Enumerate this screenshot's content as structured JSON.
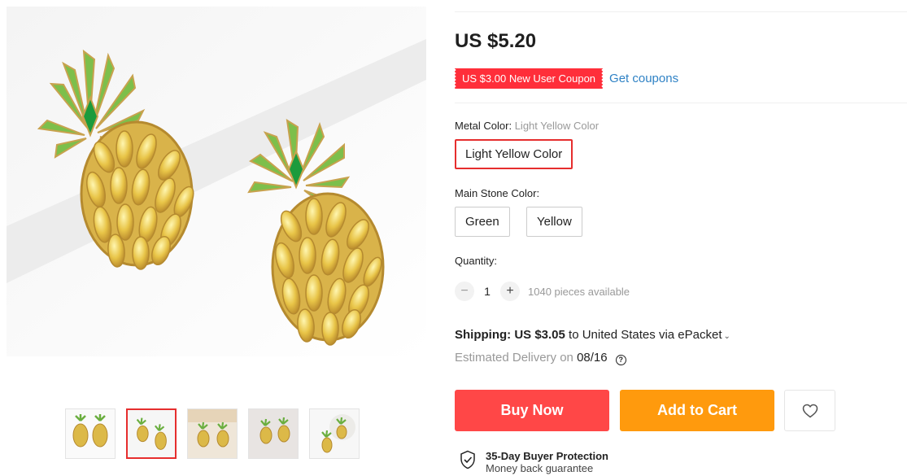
{
  "product": {
    "price": "US $5.20",
    "coupon_label": "US $3.00 New User Coupon",
    "get_coupons_label": "Get coupons"
  },
  "metal_color": {
    "label": "Metal Color: ",
    "selected_value": "Light Yellow Color",
    "options": [
      "Light Yellow Color"
    ]
  },
  "main_stone_color": {
    "label": "Main Stone Color:",
    "options": [
      "Green",
      "Yellow"
    ]
  },
  "quantity": {
    "label": "Quantity:",
    "minus": "−",
    "value": "1",
    "plus": "+",
    "available": "1040 pieces available"
  },
  "shipping": {
    "label": "Shipping:",
    "cost": "US $3.05",
    "destination": "to United States via ePacket",
    "chevron": "⌄"
  },
  "delivery": {
    "label": "Estimated Delivery on",
    "date": "08/16",
    "help_icon": "?"
  },
  "actions": {
    "buy_now": "Buy Now",
    "add_to_cart": "Add to Cart",
    "wishlist_icon": "heart-icon"
  },
  "protection": {
    "title": "35-Day Buyer Protection",
    "subtitle": "Money back guarantee",
    "icon": "shield-check-icon"
  },
  "gallery": {
    "thumbnail_count": 5,
    "active_thumbnail": 2
  },
  "colors": {
    "price": "#1f1f1f",
    "coupon_bg": "#ff2e3a",
    "link": "#2f82c5",
    "selected_border": "#e62e2e",
    "buy_now": "#ff4747",
    "add_to_cart": "#ff9a0d"
  }
}
